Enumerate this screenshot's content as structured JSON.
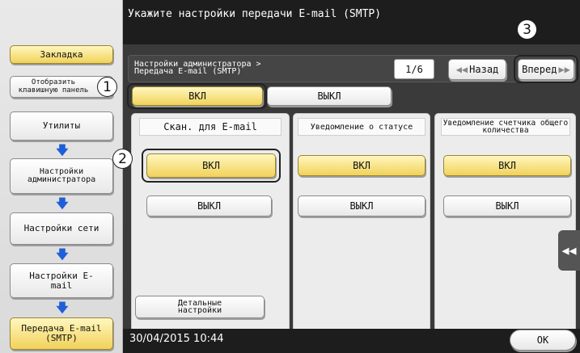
{
  "header": {
    "title": "Укажите настройки передачи  E-mail (SMTP)"
  },
  "sidebar": {
    "bookmark": "Закладка",
    "show_keypad": "Отобразить клавишную панель",
    "items": [
      {
        "label": "Утилиты"
      },
      {
        "label": "Настройки администратора"
      },
      {
        "label": "Настройки сети"
      },
      {
        "label": "Настройки E-mail"
      },
      {
        "label": "Передача E-mail (SMTP)"
      }
    ]
  },
  "nav": {
    "breadcrumb_line1": "Настройки администратора >",
    "breadcrumb_line2": "Передача E-mail (SMTP)",
    "page": "1/6",
    "back_label": "Назад",
    "forward_label": "Вперед"
  },
  "main_toggle": {
    "on_label": "ВКЛ",
    "off_label": "ВЫКЛ",
    "selected": "ВКЛ"
  },
  "columns": [
    {
      "heading": "Скан. для E-mail",
      "on_label": "ВКЛ",
      "off_label": "ВЫКЛ",
      "selected": "ВКЛ"
    },
    {
      "heading": "Уведомление о статусе",
      "on_label": "ВКЛ",
      "off_label": "ВЫКЛ",
      "selected": "ВКЛ"
    },
    {
      "heading": "Уведомление счетчика общего количества",
      "on_label": "ВКЛ",
      "off_label": "ВЫКЛ",
      "selected": "ВКЛ"
    }
  ],
  "detail_settings": "Детальные настройки",
  "footer": {
    "datetime": "30/04/2015  10:44",
    "ok_label": "OK"
  },
  "callouts": [
    "1",
    "2",
    "3"
  ],
  "colors": {
    "selected": "#f1d25a",
    "panel": "#3a3a3a",
    "bar": "#1d1d1d"
  }
}
